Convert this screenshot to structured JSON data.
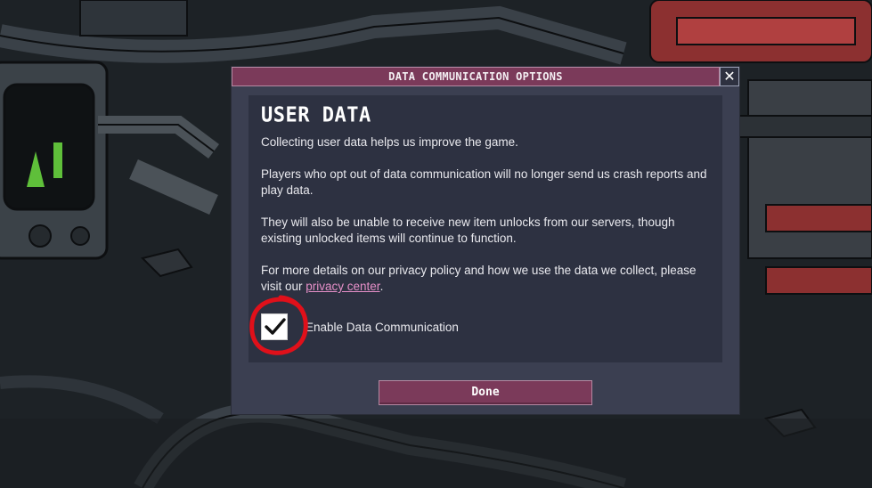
{
  "dialog": {
    "title": "DATA COMMUNICATION OPTIONS",
    "close_label": "✕",
    "heading": "USER DATA",
    "paragraphs": {
      "p1": "Collecting user data helps us improve the game.",
      "p2": "Players who opt out of data communication will no longer send us crash reports and play data.",
      "p3": "They will also be unable to receive new item unlocks from our servers, though existing unlocked items will continue to function.",
      "p4_before_link": "For more details on our privacy policy and how we use the data we collect, please visit our ",
      "p4_link": "privacy center",
      "p4_after_link": "."
    },
    "checkbox": {
      "label": "Enable Data Communication",
      "checked": true
    },
    "done_label": "Done"
  },
  "colors": {
    "accent": "#7b3a5a",
    "link": "#e58fc8",
    "annotation": "#e0101a",
    "panel": "#2d3141",
    "dialog": "#3b3f51"
  },
  "icons": {
    "close": "close-icon",
    "check": "checkmark-icon"
  }
}
